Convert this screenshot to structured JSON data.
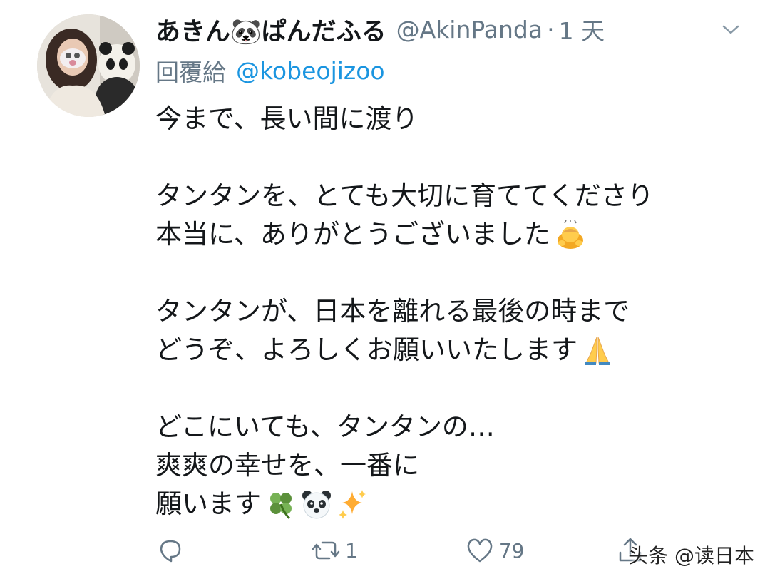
{
  "tweet": {
    "display_name": "あきん🐼ぱんだふる",
    "handle": "@AkinPanda",
    "separator": "·",
    "time": "1 天",
    "reply_prefix": "回覆給",
    "reply_to": "@kobeojizoo",
    "lines": [
      "今まで、長い間に渡り",
      "タンタンを、とても大切に育ててくださり",
      "本当に、ありがとうございました",
      "タンタンが、日本を離れる最後の時まで",
      "どうぞ、よろしくお願いいたします",
      "どこにいても、タンタンの…",
      "爽爽の幸せを、一番に",
      "願います"
    ],
    "emojis": [
      "person-bowing-icon",
      "folded-hands-icon",
      "four-leaf-clover-icon",
      "panda-face-icon",
      "sparkles-icon"
    ]
  },
  "actions": {
    "reply_count": "",
    "retweet_count": "1",
    "like_count": "79"
  },
  "watermark": "头条 @读日本",
  "colors": {
    "text": "#14171a",
    "secondary": "#657786",
    "link": "#1b95e0",
    "background": "#ffffff"
  }
}
